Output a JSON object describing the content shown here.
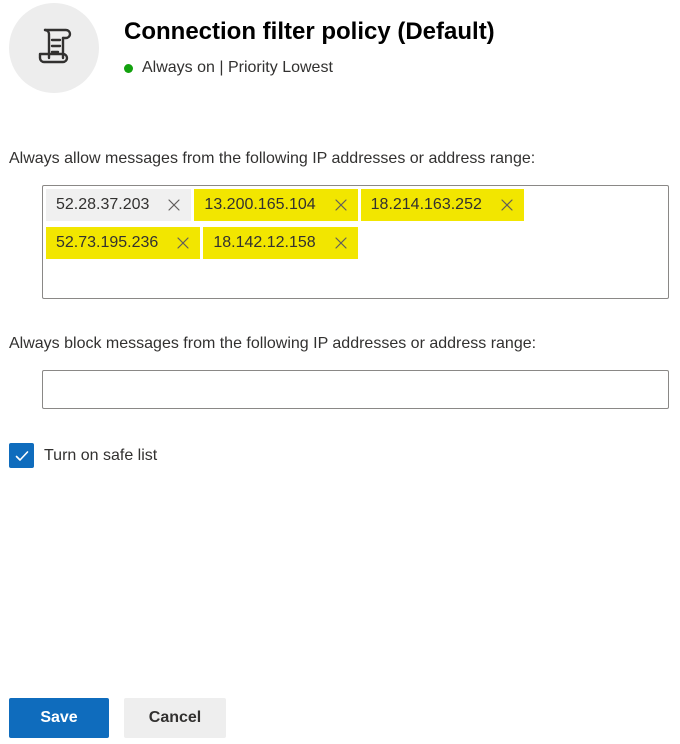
{
  "header": {
    "title": "Connection filter policy (Default)",
    "status_text": "Always on | Priority Lowest",
    "status_color": "#13a10e",
    "avatar_icon": "scroll-icon"
  },
  "allow_list": {
    "label": "Always allow messages from the following IP addresses or address range:",
    "entries": [
      {
        "value": "52.28.37.203",
        "highlighted": false
      },
      {
        "value": "13.200.165.104",
        "highlighted": true
      },
      {
        "value": "18.214.163.252",
        "highlighted": true
      },
      {
        "value": "52.73.195.236",
        "highlighted": true
      },
      {
        "value": "18.142.12.158",
        "highlighted": true
      }
    ]
  },
  "block_list": {
    "label": "Always block messages from the following IP addresses or address range:",
    "value": ""
  },
  "safe_list": {
    "label": "Turn on safe list",
    "checked": true
  },
  "actions": {
    "save_label": "Save",
    "cancel_label": "Cancel"
  },
  "colors": {
    "accent": "#0f6cbd",
    "highlight": "#f2e600",
    "tag_background": "#f0f0f0"
  }
}
